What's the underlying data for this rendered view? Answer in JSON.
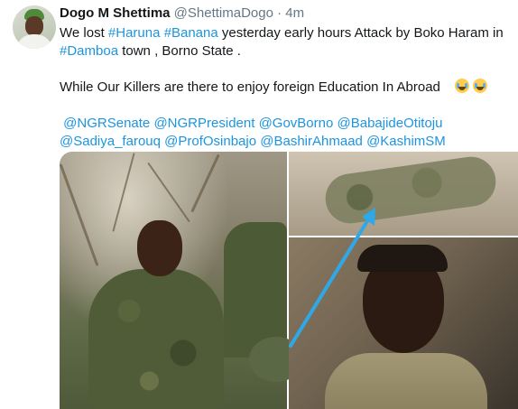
{
  "tweet": {
    "name": "Dogo M Shettima",
    "handle": "@ShettimaDogo",
    "separator": "·",
    "time": "4m",
    "line1": {
      "pre": "We lost ",
      "tag1": "#Haruna",
      "sp": " ",
      "tag2": "#Banana",
      "post": " yesterday early hours Attack by Boko Haram in"
    },
    "line2": {
      "tag": "#Damboa",
      "post": " town , Borno State ."
    },
    "line3": "While Our Killers are there to enjoy foreign Education In Abroad",
    "emoji": [
      "loudly-crying-face-emoji",
      "loudly-crying-face-emoji"
    ],
    "mentions_line1": [
      "@NGRSenate",
      "@NGRPresident",
      "@GovBorno",
      "@BabajideOtitoju"
    ],
    "mentions_line2": [
      "@Sadiya_farouq",
      "@ProfOsinbajo",
      "@BashirAhmaad",
      "@KashimSM"
    ]
  },
  "colors": {
    "link": "#1b95e0",
    "text": "#14171a",
    "muted": "#657786",
    "arrow": "#2fa8e8"
  },
  "media": {
    "photos": [
      "soldier-in-forest-photo",
      "fallen-soldiers-photo",
      "selfie-photo"
    ]
  }
}
